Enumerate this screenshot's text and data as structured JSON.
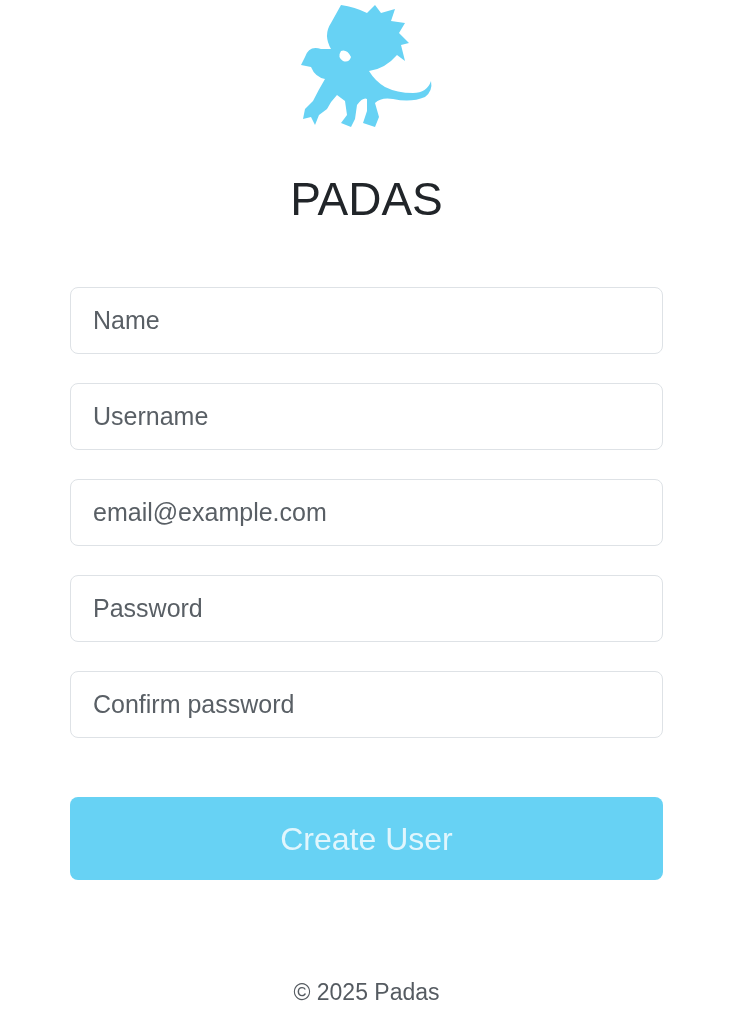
{
  "brand": {
    "title": "PADAS"
  },
  "form": {
    "fields": [
      {
        "placeholder": "Name"
      },
      {
        "placeholder": "Username"
      },
      {
        "placeholder": "email@example.com"
      },
      {
        "placeholder": "Password"
      },
      {
        "placeholder": "Confirm password"
      }
    ],
    "submit": {
      "label": "Create User",
      "disabled": true
    }
  },
  "footer": {
    "text": "© 2025 Padas"
  }
}
